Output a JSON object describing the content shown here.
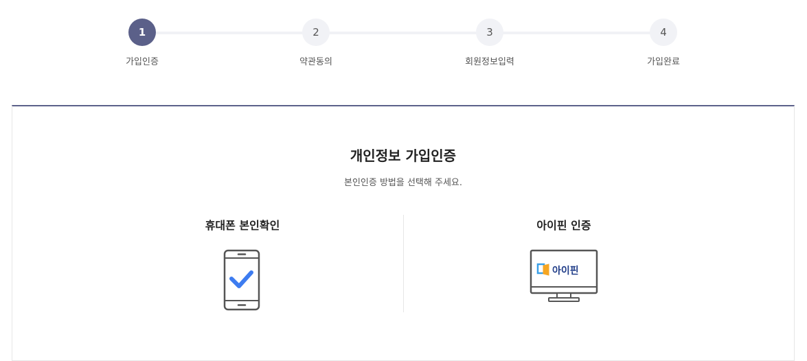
{
  "steps": [
    {
      "number": "1",
      "label": "가입인증"
    },
    {
      "number": "2",
      "label": "약관동의"
    },
    {
      "number": "3",
      "label": "회원정보입력"
    },
    {
      "number": "4",
      "label": "가입완료"
    }
  ],
  "panel": {
    "title": "개인정보 가입인증",
    "subtitle": "본인인증 방법을 선택해 주세요."
  },
  "methods": {
    "phone": {
      "title": "휴대폰 본인확인",
      "icon": "phone-check-icon"
    },
    "ipin": {
      "title": "아이핀 인증",
      "icon": "monitor-ipin-icon",
      "logo_text": "아이핀"
    }
  },
  "colors": {
    "accent": "#5b6089",
    "step_inactive": "#f1f2f6",
    "check_blue": "#3d7cf0",
    "ipin_navy": "#1f3c88"
  }
}
